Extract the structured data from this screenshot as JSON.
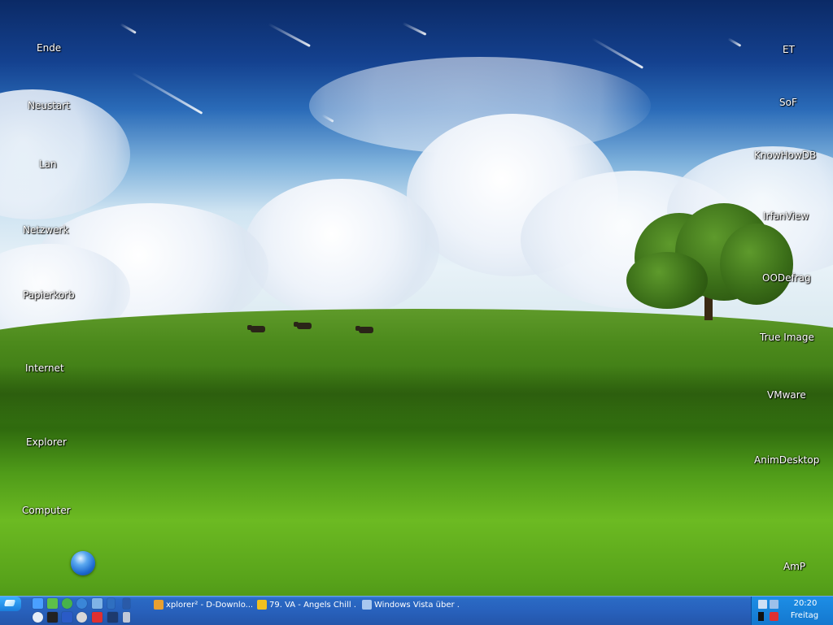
{
  "desktop": {
    "left_icons": [
      {
        "name": "desktop-icon-ende",
        "label": "Ende"
      },
      {
        "name": "desktop-icon-neustart",
        "label": "Neustart"
      },
      {
        "name": "desktop-icon-lan",
        "label": "Lan"
      },
      {
        "name": "desktop-icon-netzwerk",
        "label": "Netzwerk"
      },
      {
        "name": "desktop-icon-papierkorb",
        "label": "Papierkorb"
      },
      {
        "name": "desktop-icon-internet",
        "label": "Internet"
      },
      {
        "name": "desktop-icon-explorer",
        "label": "Explorer"
      },
      {
        "name": "desktop-icon-computer",
        "label": "Computer"
      }
    ],
    "right_icons": [
      {
        "name": "desktop-icon-et",
        "label": "ET"
      },
      {
        "name": "desktop-icon-sof",
        "label": "SoF"
      },
      {
        "name": "desktop-icon-knowhowdb",
        "label": "KnowHowDB"
      },
      {
        "name": "desktop-icon-irfanview",
        "label": "IrfanView"
      },
      {
        "name": "desktop-icon-oodefrag",
        "label": "OODefrag"
      },
      {
        "name": "desktop-icon-true-image",
        "label": "True Image"
      },
      {
        "name": "desktop-icon-vmware",
        "label": "VMware"
      },
      {
        "name": "desktop-icon-animdesktop",
        "label": "AnimDesktop"
      },
      {
        "name": "desktop-icon-amp",
        "label": "AmP"
      }
    ]
  },
  "taskbar": {
    "quick_launch": [
      {
        "name": "ql-icon-1",
        "color": "#4aa0ff"
      },
      {
        "name": "ql-icon-2",
        "color": "#5ec04a"
      },
      {
        "name": "ql-icon-3",
        "color": "#47b34a"
      },
      {
        "name": "ql-icon-ie",
        "color": "#3a86d8"
      },
      {
        "name": "ql-icon-5",
        "color": "#7fb3e6"
      },
      {
        "name": "ql-icon-6",
        "color": "#2f6fc0"
      },
      {
        "name": "ql-icon-7",
        "color": "#2a5aa8"
      },
      {
        "name": "ql-icon-8",
        "color": "#e6eef8"
      },
      {
        "name": "ql-icon-9",
        "color": "#222222"
      },
      {
        "name": "ql-icon-w",
        "color": "#2a5bc7"
      },
      {
        "name": "ql-icon-11",
        "color": "#d8d8d8"
      },
      {
        "name": "ql-icon-12",
        "color": "#e03030"
      },
      {
        "name": "ql-icon-13",
        "color": "#1e3a6e"
      },
      {
        "name": "ql-icon-14",
        "color": "#c0c8d8"
      }
    ],
    "tasks": [
      {
        "name": "task-xplorer",
        "label": "xplorer² - D-Downlo...",
        "icon_color": "#e8a030"
      },
      {
        "name": "task-va-angels",
        "label": "79. VA - Angels Chill ...",
        "icon_color": "#f0c020"
      },
      {
        "name": "task-windows-vista",
        "label": "Windows Vista über ...",
        "icon_color": "#a8c8f0"
      }
    ],
    "clock": {
      "time": "20:20",
      "day": "Freitag"
    }
  }
}
